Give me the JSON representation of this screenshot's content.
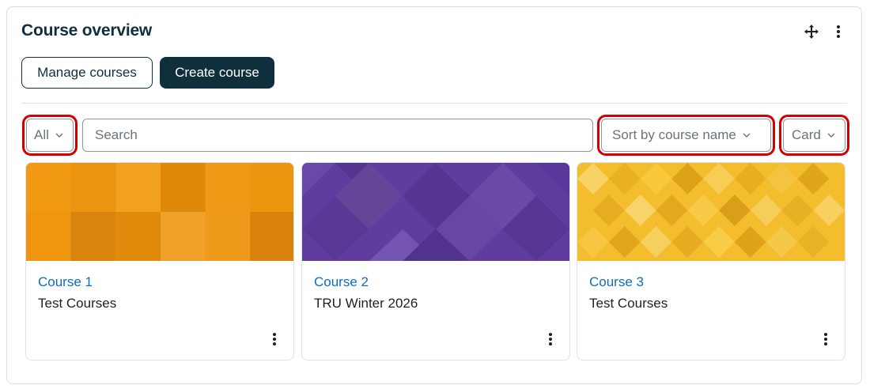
{
  "block": {
    "title": "Course overview",
    "move_icon": "move-icon",
    "menu_icon": "kebab-menu-icon"
  },
  "actions": {
    "manage_label": "Manage courses",
    "create_label": "Create course"
  },
  "filters": {
    "grouping_value": "All",
    "search_placeholder": "Search",
    "sort_value": "Sort by course name",
    "view_value": "Card"
  },
  "courses": [
    {
      "name": "Course 1",
      "category": "Test Courses",
      "pattern_color": "#f0960e"
    },
    {
      "name": "Course 2",
      "category": "TRU Winter 2026",
      "pattern_color": "#5f3c9e"
    },
    {
      "name": "Course 3",
      "category": "Test Courses",
      "pattern_color": "#f3bd2d"
    }
  ],
  "colors": {
    "primary_dark": "#0f2f3d",
    "link": "#0f6cbf",
    "highlight": "#d40000"
  }
}
